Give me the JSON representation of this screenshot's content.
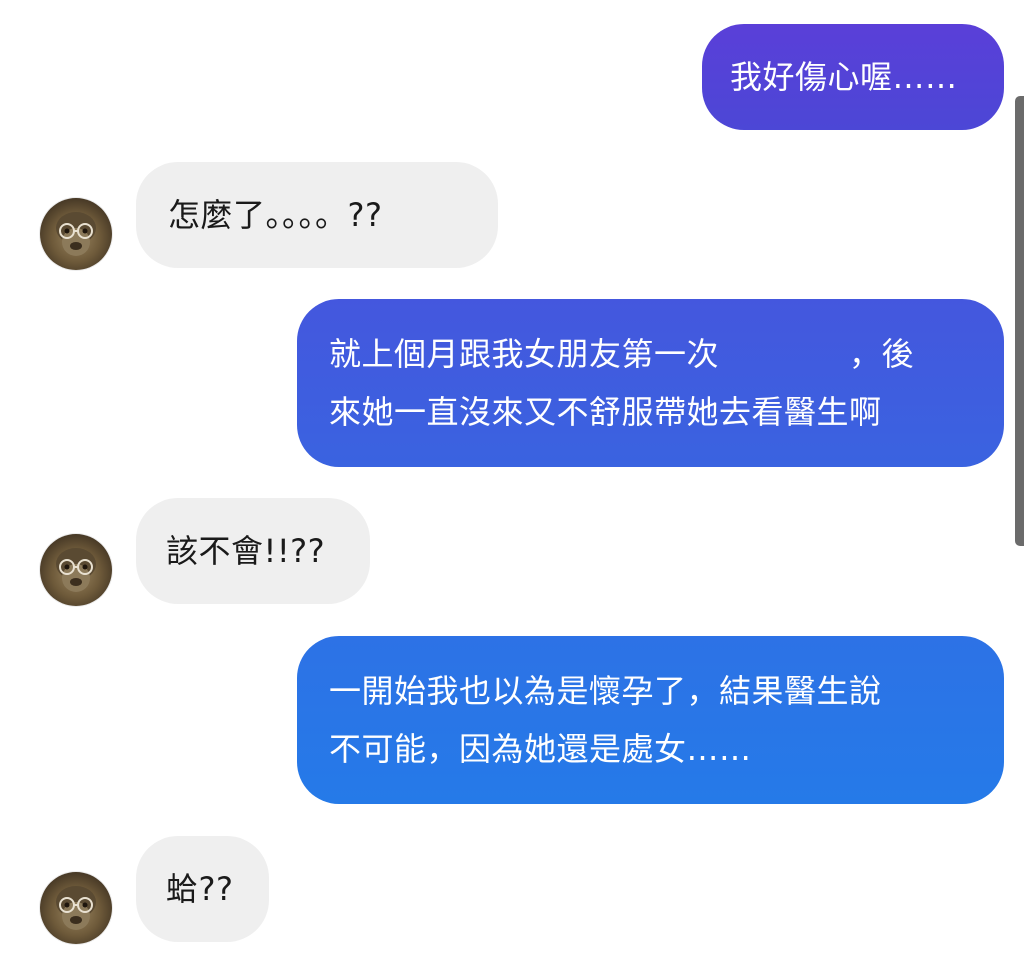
{
  "messages": [
    {
      "id": "m1",
      "side": "outgoing",
      "text": "我好傷心喔……"
    },
    {
      "id": "m2",
      "side": "incoming",
      "text": "怎麼了。。。。??"
    },
    {
      "id": "m3",
      "side": "outgoing",
      "text": "就上個月跟我女朋友第一次　　　　，後\n來她一直沒來又不舒服帶她去看醫生啊"
    },
    {
      "id": "m4",
      "side": "incoming",
      "text": "該不會!!??"
    },
    {
      "id": "m5",
      "side": "outgoing",
      "text": "一開始我也以為是懷孕了，結果醫生說\n不可能，因為她還是處女……"
    },
    {
      "id": "m6",
      "side": "incoming",
      "text": "蛤??"
    }
  ],
  "avatar": {
    "icon": "monkey-face-avatar"
  },
  "colors": {
    "outgoing_top": "#5a3fd8",
    "outgoing_bottom": "#257ae8",
    "incoming_bg": "#efefef",
    "incoming_text": "#1a1a1a"
  }
}
